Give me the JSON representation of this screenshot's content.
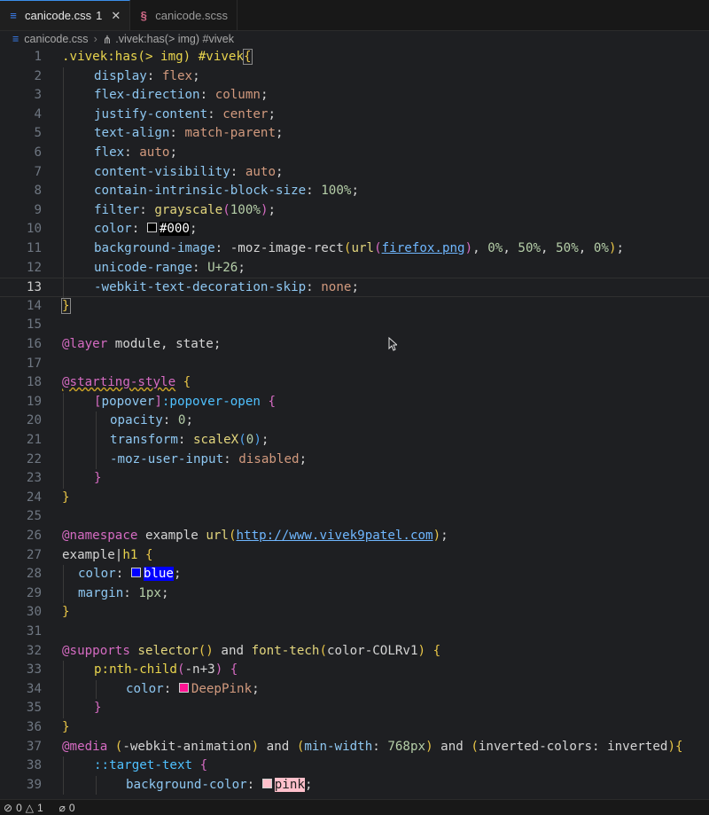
{
  "tabs": [
    {
      "label": "canicode.css",
      "modified": "1",
      "icon": "css-file-icon",
      "active": true
    },
    {
      "label": "canicode.scss",
      "icon": "scss-file-icon",
      "active": false
    }
  ],
  "breadcrumb": {
    "file": "canicode.css",
    "symbol": ".vivek:has(> img) #vivek"
  },
  "line_numbers": [
    "1",
    "2",
    "3",
    "4",
    "5",
    "6",
    "7",
    "8",
    "9",
    "10",
    "11",
    "12",
    "13",
    "14",
    "15",
    "16",
    "17",
    "18",
    "19",
    "20",
    "21",
    "22",
    "23",
    "24",
    "25",
    "26",
    "27",
    "28",
    "29",
    "30",
    "31",
    "32",
    "33",
    "34",
    "35",
    "36",
    "37",
    "38",
    "39"
  ],
  "code": {
    "l1_sel": ".vivek:has(> img) #vivek",
    "l1_open": "{",
    "l2_p": "display",
    "l2_v": "flex",
    "l3_p": "flex-direction",
    "l3_v": "column",
    "l4_p": "justify-content",
    "l4_v": "center",
    "l5_p": "text-align",
    "l5_v": "match-parent",
    "l6_p": "flex",
    "l6_v": "auto",
    "l7_p": "content-visibility",
    "l7_v": "auto",
    "l8_p": "contain-intrinsic-block-size",
    "l8_v": "100%",
    "l9_p": "filter",
    "l9_fn": "grayscale",
    "l9_n": "100%",
    "l10_p": "color",
    "l10_v": "#000",
    "l11_p": "background-image",
    "l11_fn": "-moz-image-rect",
    "l11_url": "url",
    "l11_file": "firefox.png",
    "l11_n1": "0%",
    "l11_n2": "50%",
    "l11_n3": "50%",
    "l11_n4": "0%",
    "l12_p": "unicode-range",
    "l12_v": "U+26",
    "l13_p": "-webkit-text-decoration-skip",
    "l13_v": "none",
    "l14_close": "}",
    "l16_at": "@layer",
    "l16_rest": "module, state",
    "l18_at": "@starting-style",
    "l19_attr": "popover",
    "l19_pseudo": ":popover-open",
    "l20_p": "opacity",
    "l20_v": "0",
    "l21_p": "transform",
    "l21_fn": "scaleX",
    "l21_n": "0",
    "l22_p": "-moz-user-input",
    "l22_v": "disabled",
    "l26_at": "@namespace",
    "l26_name": "example",
    "l26_url": "url",
    "l26_link": "http://www.vivek9patel.com",
    "l27_ns": "example",
    "l27_el": "h1",
    "l28_p": "color",
    "l28_v": "blue",
    "l29_p": "margin",
    "l29_v": "1px",
    "l32_at": "@supports",
    "l32_fn1": "selector",
    "l32_and": "and",
    "l32_fn2": "font-tech",
    "l32_arg": "color-COLRv1",
    "l33_sel": "p:nth-child",
    "l33_arg": "-n+3",
    "l34_p": "color",
    "l34_v": "DeepPink",
    "l37_at": "@media",
    "l37_f1": "-webkit-animation",
    "l37_and1": "and",
    "l37_f2p": "min-width",
    "l37_f2v": "768px",
    "l37_and2": "and",
    "l37_f3p": "inverted-colors",
    "l37_f3v": "inverted",
    "l38_pseudo": "::target-text",
    "l39_p": "background-color",
    "l39_v": "pink"
  },
  "status": {
    "errors": "0",
    "warnings": "1",
    "ports": "0"
  },
  "colors": {
    "tab_accent": "#3b8eea",
    "swatch_black": "#000000",
    "swatch_blue": "#0000ff",
    "swatch_deeppink": "#ff1493",
    "swatch_pink": "#ffc0cb"
  }
}
